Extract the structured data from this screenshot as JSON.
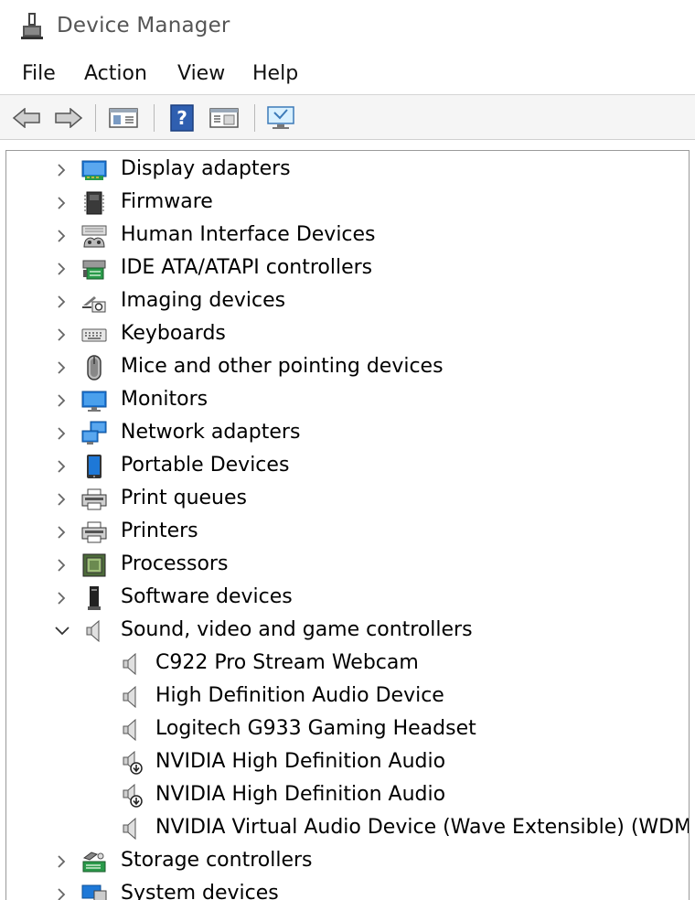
{
  "window": {
    "title": "Device Manager"
  },
  "menu": [
    "File",
    "Action",
    "View",
    "Help"
  ],
  "tree": {
    "categories_top": [
      {
        "label": "Display adapters",
        "icon": "display-adapter-icon"
      },
      {
        "label": "Firmware",
        "icon": "firmware-chip-icon"
      },
      {
        "label": "Human Interface Devices",
        "icon": "hid-icon"
      },
      {
        "label": "IDE ATA/ATAPI controllers",
        "icon": "ide-controller-icon"
      },
      {
        "label": "Imaging devices",
        "icon": "camera-icon"
      },
      {
        "label": "Keyboards",
        "icon": "keyboard-icon"
      },
      {
        "label": "Mice and other pointing devices",
        "icon": "mouse-icon"
      },
      {
        "label": "Monitors",
        "icon": "monitor-icon"
      },
      {
        "label": "Network adapters",
        "icon": "network-adapter-icon"
      },
      {
        "label": "Portable Devices",
        "icon": "portable-device-icon"
      },
      {
        "label": "Print queues",
        "icon": "printer-icon"
      },
      {
        "label": "Printers",
        "icon": "printer-icon"
      },
      {
        "label": "Processors",
        "icon": "processor-icon"
      },
      {
        "label": "Software devices",
        "icon": "software-device-icon"
      }
    ],
    "expanded": {
      "label": "Sound, video and game controllers",
      "icon": "speaker-icon",
      "children": [
        {
          "label": "C922 Pro Stream Webcam",
          "icon": "speaker-icon"
        },
        {
          "label": "High Definition Audio Device",
          "icon": "speaker-icon"
        },
        {
          "label": "Logitech G933 Gaming Headset",
          "icon": "speaker-icon"
        },
        {
          "label": "NVIDIA High Definition Audio",
          "icon": "speaker-disabled-icon"
        },
        {
          "label": "NVIDIA High Definition Audio",
          "icon": "speaker-disabled-icon"
        },
        {
          "label": "NVIDIA Virtual Audio Device (Wave Extensible) (WDM)",
          "icon": "speaker-icon"
        }
      ]
    },
    "categories_bottom": [
      {
        "label": "Storage controllers",
        "icon": "storage-controller-icon"
      },
      {
        "label": "System devices",
        "icon": "system-device-icon"
      }
    ]
  },
  "colors": {
    "accent_blue": "#1e78d7",
    "chevron": "#666666",
    "title_text": "#555555"
  }
}
